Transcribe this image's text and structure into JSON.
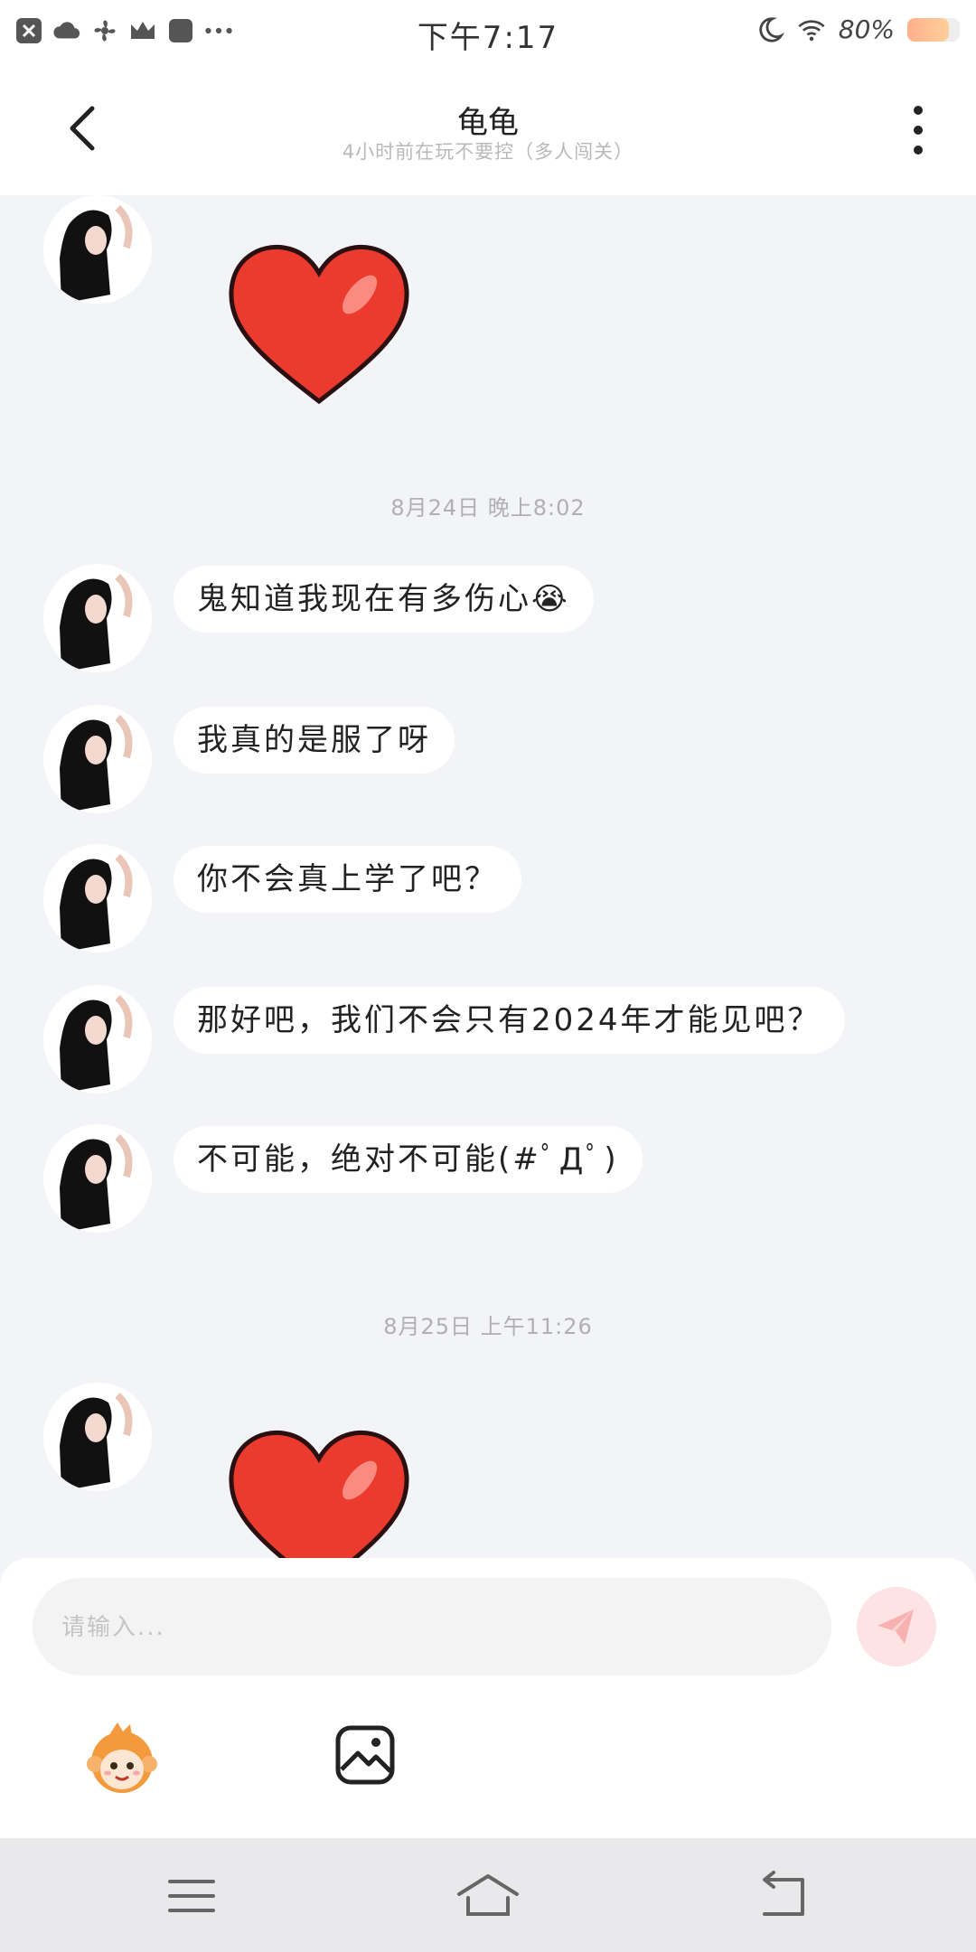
{
  "status_bar": {
    "time": "下午7:17",
    "battery_text": "80%",
    "battery_level": 0.8,
    "icons": [
      "close-icon",
      "cloud-icon",
      "fan-icon",
      "crown-icon",
      "app-square-icon",
      "more-dots-icon",
      "moon-icon",
      "wifi-icon",
      "battery-icon"
    ]
  },
  "header": {
    "title": "龟龟",
    "subtitle": "4小时前在玩不要控（多人闯关）"
  },
  "chat": {
    "separators": [
      {
        "text": "8月24日 晚上8:02"
      },
      {
        "text": "8月25日 上午11:26"
      }
    ],
    "messages": [
      {
        "type": "sticker",
        "sticker": "red-heart"
      },
      {
        "type": "text",
        "text": "鬼知道我现在有多伤心😭"
      },
      {
        "type": "text",
        "text": "我真的是服了呀"
      },
      {
        "type": "text",
        "text": "你不会真上学了吧？"
      },
      {
        "type": "text",
        "text": "那好吧，我们不会只有2024年才能见吧？"
      },
      {
        "type": "text",
        "text": "不可能，绝对不可能(#ﾟДﾟ)"
      },
      {
        "type": "sticker",
        "sticker": "red-heart"
      }
    ]
  },
  "composer": {
    "placeholder": "请输入...",
    "value": ""
  },
  "colors": {
    "chat_background": "#f3f4f8",
    "send_button": "#fde3e3",
    "send_icon": "#f6a6a6"
  }
}
